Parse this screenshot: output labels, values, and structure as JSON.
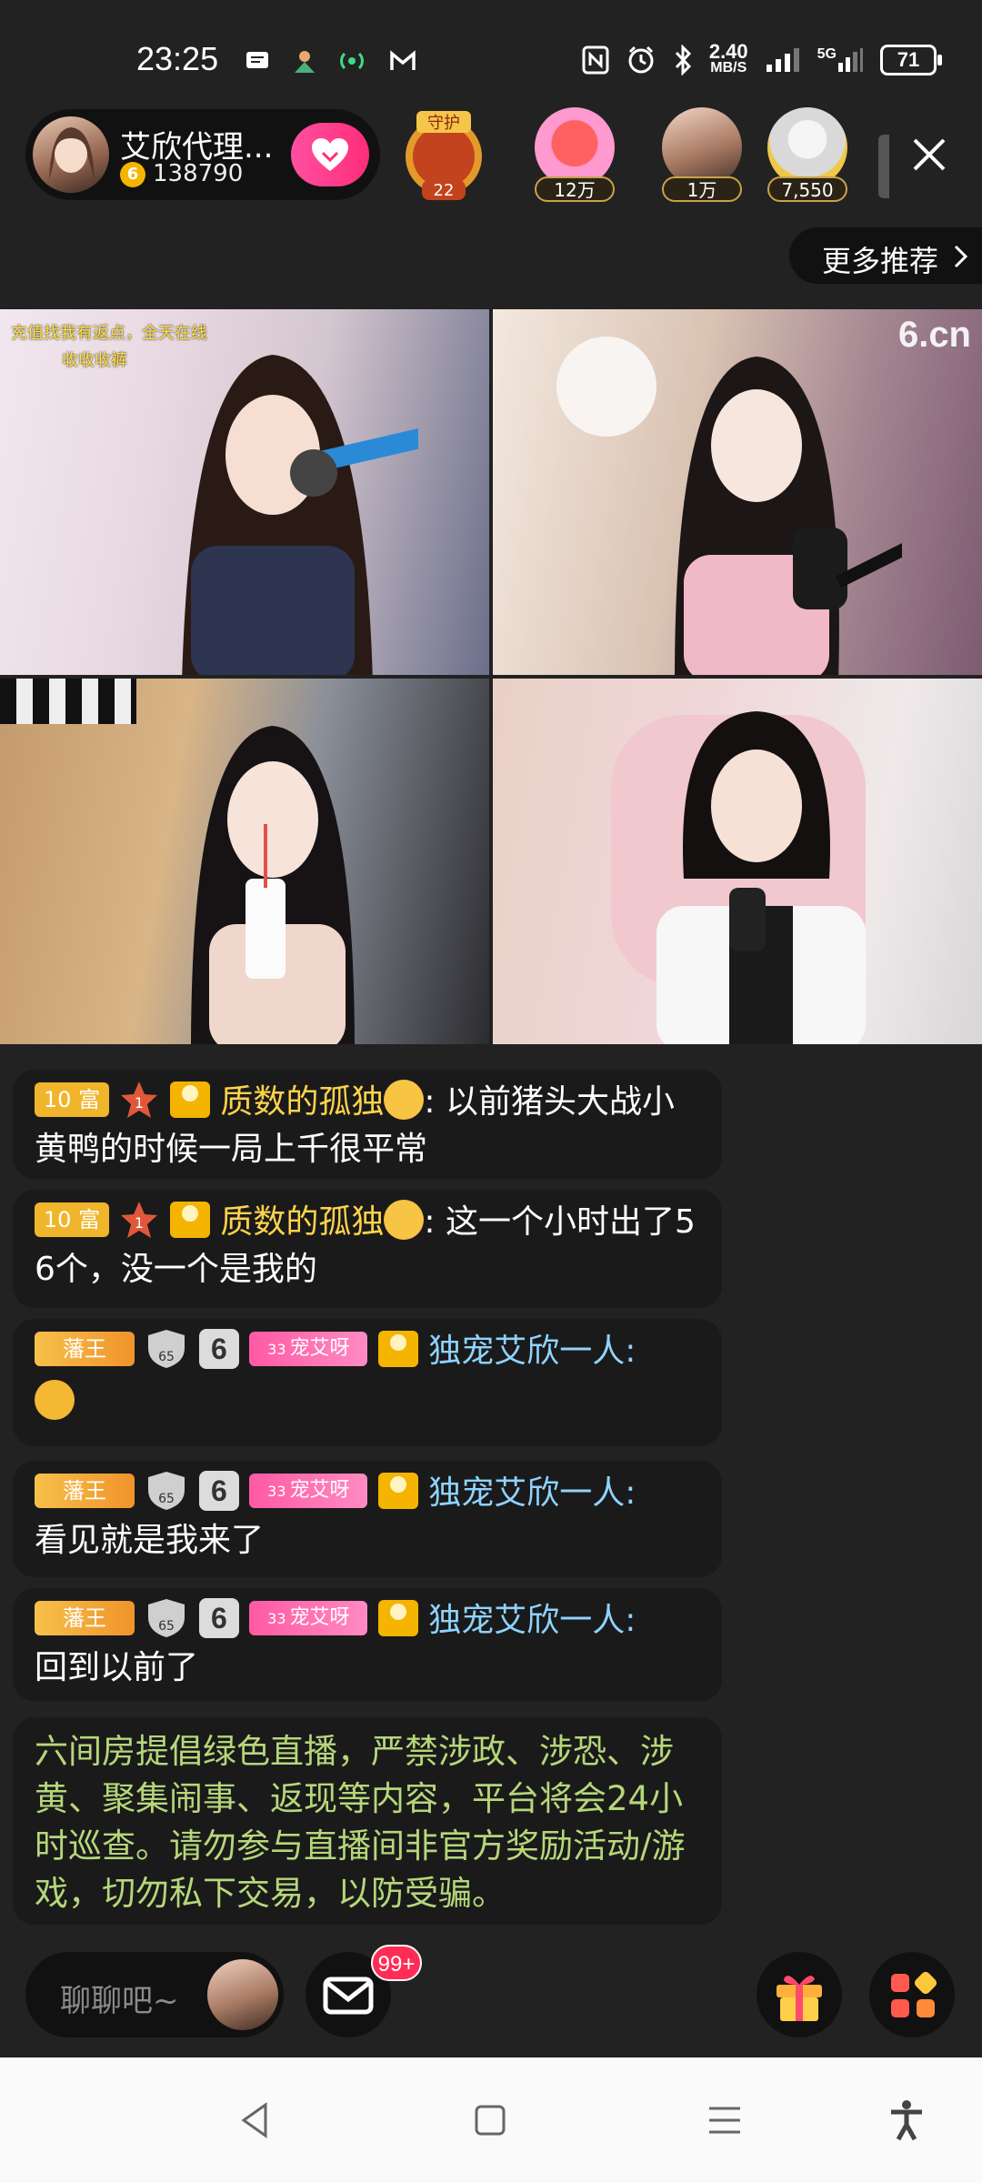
{
  "status_bar": {
    "time": "23:25",
    "net_speed_value": "2.40",
    "net_speed_unit": "MB/S",
    "network": "5G",
    "battery": "71"
  },
  "host": {
    "name": "艾欣代理...",
    "coins": "138790",
    "coin_symbol": "6"
  },
  "viewers": [
    {
      "badge": "守护",
      "count": "22"
    },
    {
      "count": "12万"
    },
    {
      "count": "1万"
    },
    {
      "count": "7,550"
    }
  ],
  "more_recommend": "更多推荐",
  "video": {
    "tile1_note_line1": "充值找我有返点，全天在线",
    "tile1_note_line2": "收收收裤",
    "tile2_logo": "6.cn"
  },
  "chat": [
    {
      "level": "10 富",
      "star": "1",
      "user": "质数的孤独",
      "sep": ": ",
      "text": "以前猪头大战小黄鸭的时候一局上千很平常"
    },
    {
      "level": "10 富",
      "star": "1",
      "user": "质数的孤独",
      "sep": ": ",
      "text": "这一个小时出了5  6个，没一个是我的"
    },
    {
      "fan": "藩王",
      "shield": "65",
      "six": "6",
      "pet": "宠艾呀",
      "pet_lvl": "33",
      "user": "独宠艾欣一人",
      "sep": ":",
      "text": ""
    },
    {
      "fan": "藩王",
      "shield": "65",
      "six": "6",
      "pet": "宠艾呀",
      "pet_lvl": "33",
      "user": "独宠艾欣一人",
      "sep": ":",
      "text": "看见就是我来了"
    },
    {
      "fan": "藩王",
      "shield": "65",
      "six": "6",
      "pet": "宠艾呀",
      "pet_lvl": "33",
      "user": "独宠艾欣一人",
      "sep": ":",
      "text": "回到以前了"
    }
  ],
  "notice": "六间房提倡绿色直播，严禁涉政、涉恐、涉黄、聚集闹事、返现等内容，平台将会24小时巡查。请勿参与直播间非官方奖励活动/游戏，切勿私下交易，以防受骗。",
  "bottom": {
    "input_placeholder": "聊聊吧~",
    "msg_badge": "99+"
  },
  "colors": {
    "background": "#222222",
    "bubble": "#1a1a1a",
    "notice_text": "#b5d77a",
    "username_gold": "#ffd34a",
    "username_blue": "#8fd3ff",
    "accent_pink": "#ff2d7a"
  },
  "icons": [
    "message-icon",
    "nfc-icon",
    "alarm-icon",
    "bluetooth-icon",
    "signal-icon",
    "close-icon",
    "chevron-right-icon",
    "mail-icon",
    "gift-icon",
    "apps-icon",
    "back-icon",
    "home-icon",
    "menu-icon",
    "accessibility-icon"
  ]
}
